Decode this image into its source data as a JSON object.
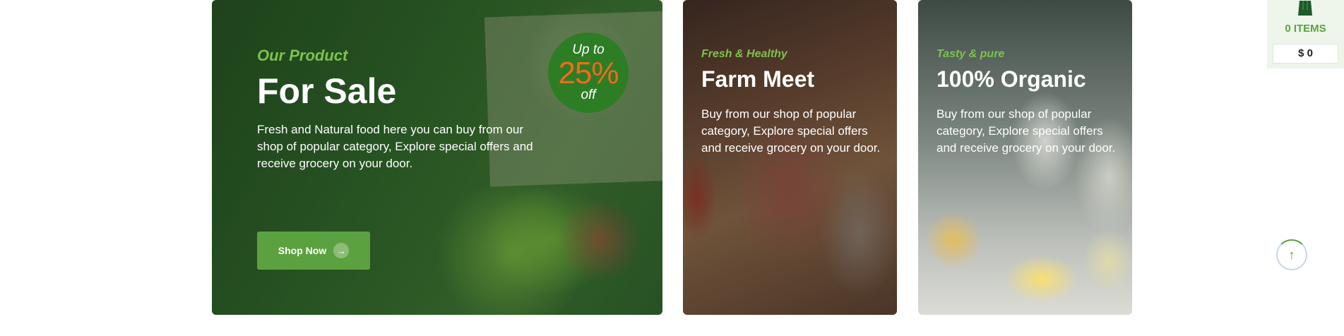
{
  "colors": {
    "accent_green": "#5ca13f",
    "eyebrow_green": "#7cc34c",
    "badge_green": "#2d7d25",
    "discount_orange": "#f16a1c"
  },
  "banners": {
    "sale": {
      "eyebrow": "Our Product",
      "title": "For Sale",
      "description": "Fresh and Natural food here you can buy from our shop of popular category, Explore special offers and receive grocery on your door.",
      "button_label": "Shop Now",
      "button_icon": "arrow-right-icon",
      "badge": {
        "top": "Up to",
        "value": "25%",
        "bottom": "off"
      }
    },
    "meat": {
      "eyebrow": "Fresh & Healthy",
      "title": "Farm Meet",
      "description": "Buy from our shop of popular category, Explore special offers and receive grocery on your door."
    },
    "organic": {
      "eyebrow": "Tasty & pure",
      "title": "100% Organic",
      "description": "Buy from our shop of popular category, Explore special offers and receive grocery on your door."
    }
  },
  "cart": {
    "icon": "shopping-bag-icon",
    "items_label": "0 ITEMS",
    "total": "$ 0"
  },
  "scroll_top": {
    "icon": "arrow-up-icon"
  }
}
